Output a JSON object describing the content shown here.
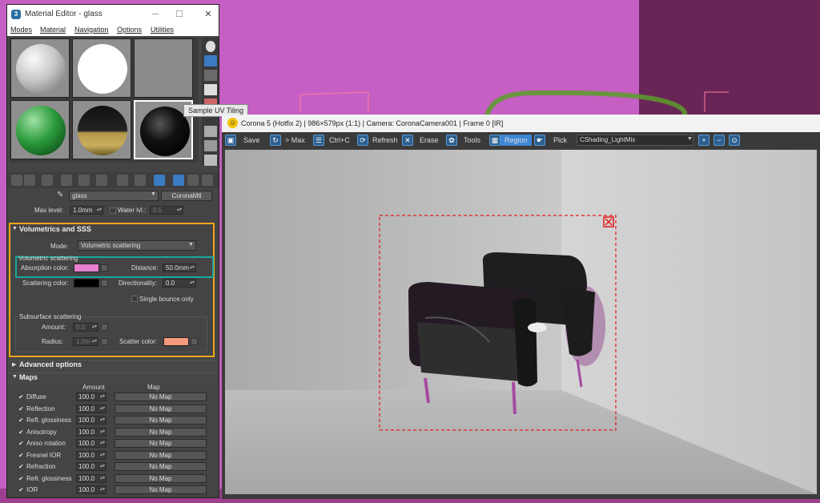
{
  "material_editor": {
    "title": "Material Editor - glass",
    "menu": [
      "Modes",
      "Material",
      "Navigation",
      "Options",
      "Utilities"
    ],
    "material_name": "glass",
    "material_type": "CoronaMtl",
    "max_level_label": "Max level:",
    "max_level_value": "1.0mm",
    "water_lvl_label": "Water lvl.:",
    "water_lvl_value": "0.5",
    "volumetrics": {
      "header": "Volumetrics and SSS",
      "mode_label": "Mode:",
      "mode_value": "Volumetric scattering",
      "vol_scatter_title": "Volumetric scattering",
      "absorption_label": "Absorption color:",
      "absorption_color": "#e77fcf",
      "distance_label": "Distance:",
      "distance_value": "50.0mm",
      "scattering_label": "Scattering color:",
      "scattering_color": "#000000",
      "directionality_label": "Directionality:",
      "directionality_value": "0.0",
      "single_bounce_label": "Single bounce only",
      "sss_title": "Subsurface scattering",
      "amount_label": "Amount:",
      "amount_value": "0.0",
      "radius_label": "Radius:",
      "radius_value": "1.0m",
      "scatter_color_label": "Scatter color:",
      "scatter_color": "#f79a7e"
    },
    "advanced_header": "Advanced options",
    "maps": {
      "header": "Maps",
      "col_amount": "Amount",
      "col_map": "Map",
      "rows": [
        {
          "check": "✔",
          "name": "Diffuse",
          "amount": "100.0",
          "map": "No Map"
        },
        {
          "check": "✔",
          "name": "Reflection",
          "amount": "100.0",
          "map": "No Map"
        },
        {
          "check": "✔",
          "name": "Refl. glossiness",
          "amount": "100.0",
          "map": "No Map"
        },
        {
          "check": "✔",
          "name": "Anisotropy",
          "amount": "100.0",
          "map": "No Map"
        },
        {
          "check": "✔",
          "name": "Aniso rotation",
          "amount": "100.0",
          "map": "No Map"
        },
        {
          "check": "✔",
          "name": "Fresnel IOR",
          "amount": "100.0",
          "map": "No Map"
        },
        {
          "check": "✔",
          "name": "Refraction",
          "amount": "100.0",
          "map": "No Map"
        },
        {
          "check": "✔",
          "name": "Refr. glossiness",
          "amount": "100.0",
          "map": "No Map"
        },
        {
          "check": "✔",
          "name": "IOR",
          "amount": "100.0",
          "map": "No Map"
        }
      ]
    }
  },
  "tooltip": "Sample UV Tiling",
  "vfb": {
    "title": "Corona 5 (Hotfix 2) | 986×579px (1:1) | Camera: CoronaCamera001 | Frame 0 [IR]",
    "toolbar": {
      "save": "Save",
      "to_max": "> Max",
      "copy": "Ctrl+C",
      "refresh": "Refresh",
      "erase": "Erase",
      "tools": "Tools",
      "region": "Region",
      "pick": "Pick",
      "lightmix": "CShading_LightMix"
    }
  }
}
